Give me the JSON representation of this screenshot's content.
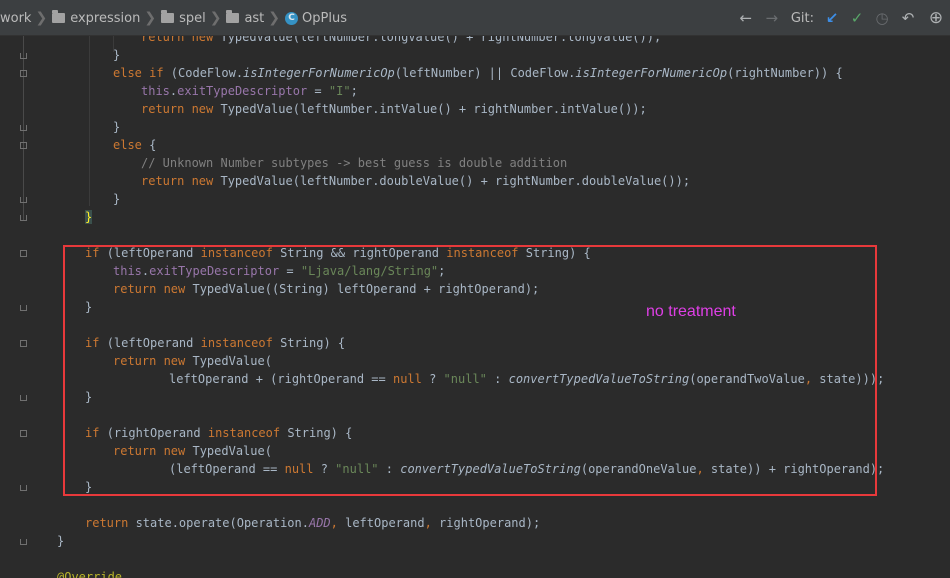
{
  "breadcrumb": [
    {
      "label": "work",
      "icon": "none"
    },
    {
      "label": "expression",
      "icon": "folder-icon"
    },
    {
      "label": "spel",
      "icon": "folder-icon"
    },
    {
      "label": "ast",
      "icon": "folder-icon"
    },
    {
      "label": "OpPlus",
      "icon": "class-icon"
    }
  ],
  "class_icon_glyph": "C",
  "toolbar": {
    "back_icon": "←",
    "forward_icon": "→",
    "git_label": "Git:",
    "update_icon": "↙",
    "commit_icon": "✓",
    "history_icon": "◷",
    "revert_icon": "↶",
    "more_icon": "⊕"
  },
  "annotation": {
    "note": "no treatment",
    "box_color": "#e8393b",
    "note_color": "#df3fe6"
  },
  "code_lines": [
    [
      [
        "kw",
        "return "
      ],
      [
        "kw",
        "new "
      ],
      [
        "p",
        "TypedValue(leftNumber.longValue() + rightNumber.longValue());"
      ]
    ],
    [
      [
        "p",
        "}"
      ]
    ],
    [
      [
        "kw",
        "else if "
      ],
      [
        "p",
        "(CodeFlow."
      ],
      [
        "it",
        "isIntegerForNumericOp"
      ],
      [
        "p",
        "(leftNumber) || CodeFlow."
      ],
      [
        "it",
        "isIntegerForNumericOp"
      ],
      [
        "p",
        "(rightNumber)) {"
      ]
    ],
    [
      [
        "fld",
        "this"
      ],
      [
        "p",
        "."
      ],
      [
        "fld",
        "exitTypeDescriptor"
      ],
      [
        "p",
        " = "
      ],
      [
        "str",
        "\"I\""
      ],
      [
        "p",
        ";"
      ]
    ],
    [
      [
        "kw",
        "return "
      ],
      [
        "kw",
        "new "
      ],
      [
        "p",
        "TypedValue(leftNumber.intValue() + rightNumber.intValue());"
      ]
    ],
    [
      [
        "p",
        "}"
      ]
    ],
    [
      [
        "kw",
        "else "
      ],
      [
        "p",
        "{"
      ]
    ],
    [
      [
        "cmt",
        "// Unknown Number subtypes -> best guess is double addition"
      ]
    ],
    [
      [
        "kw",
        "return "
      ],
      [
        "kw",
        "new "
      ],
      [
        "p",
        "TypedValue(leftNumber.doubleValue() + rightNumber.doubleValue());"
      ]
    ],
    [
      [
        "p",
        "}"
      ]
    ],
    [
      [
        "hl",
        "}"
      ]
    ],
    [],
    [
      [
        "kw",
        "if "
      ],
      [
        "p",
        "(leftOperand "
      ],
      [
        "kw",
        "instanceof "
      ],
      [
        "p",
        "String && rightOperand "
      ],
      [
        "kw",
        "instanceof "
      ],
      [
        "p",
        "String) {"
      ]
    ],
    [
      [
        "fld",
        "this"
      ],
      [
        "p",
        "."
      ],
      [
        "fld",
        "exitTypeDescriptor"
      ],
      [
        "p",
        " = "
      ],
      [
        "str",
        "\"Ljava/lang/String\""
      ],
      [
        "p",
        ";"
      ]
    ],
    [
      [
        "kw",
        "return "
      ],
      [
        "kw",
        "new "
      ],
      [
        "p",
        "TypedValue((String) leftOperand + rightOperand);"
      ]
    ],
    [
      [
        "p",
        "}"
      ]
    ],
    [],
    [
      [
        "kw",
        "if "
      ],
      [
        "p",
        "(leftOperand "
      ],
      [
        "kw",
        "instanceof "
      ],
      [
        "p",
        "String) {"
      ]
    ],
    [
      [
        "kw",
        "return "
      ],
      [
        "kw",
        "new "
      ],
      [
        "p",
        "TypedValue("
      ]
    ],
    [
      [
        "p",
        "leftOperand + (rightOperand == "
      ],
      [
        "kw",
        "null "
      ],
      [
        "p",
        "? "
      ],
      [
        "str",
        "\"null\""
      ],
      [
        "p",
        " : "
      ],
      [
        "it",
        "convertTypedValueToString"
      ],
      [
        "p",
        "(operandTwoValue"
      ],
      [
        "kw",
        ", "
      ],
      [
        "p",
        "state)));"
      ]
    ],
    [
      [
        "p",
        "}"
      ]
    ],
    [],
    [
      [
        "kw",
        "if "
      ],
      [
        "p",
        "(rightOperand "
      ],
      [
        "kw",
        "instanceof "
      ],
      [
        "p",
        "String) {"
      ]
    ],
    [
      [
        "kw",
        "return "
      ],
      [
        "kw",
        "new "
      ],
      [
        "p",
        "TypedValue("
      ]
    ],
    [
      [
        "p",
        "(leftOperand == "
      ],
      [
        "kw",
        "null "
      ],
      [
        "p",
        "? "
      ],
      [
        "str",
        "\"null\""
      ],
      [
        "p",
        " : "
      ],
      [
        "it",
        "convertTypedValueToString"
      ],
      [
        "p",
        "(operandOneValue"
      ],
      [
        "kw",
        ", "
      ],
      [
        "p",
        "state)) + rightOperand);"
      ]
    ],
    [
      [
        "p",
        "}"
      ]
    ],
    [],
    [
      [
        "kw",
        "return "
      ],
      [
        "p",
        "state.operate(Operation."
      ],
      [
        "fldit",
        "ADD"
      ],
      [
        "kw",
        ", "
      ],
      [
        "p",
        "leftOperand"
      ],
      [
        "kw",
        ", "
      ],
      [
        "p",
        "rightOperand);"
      ]
    ],
    [
      [
        "p",
        "}"
      ]
    ],
    [],
    [
      [
        "ann",
        "@Override"
      ]
    ]
  ]
}
